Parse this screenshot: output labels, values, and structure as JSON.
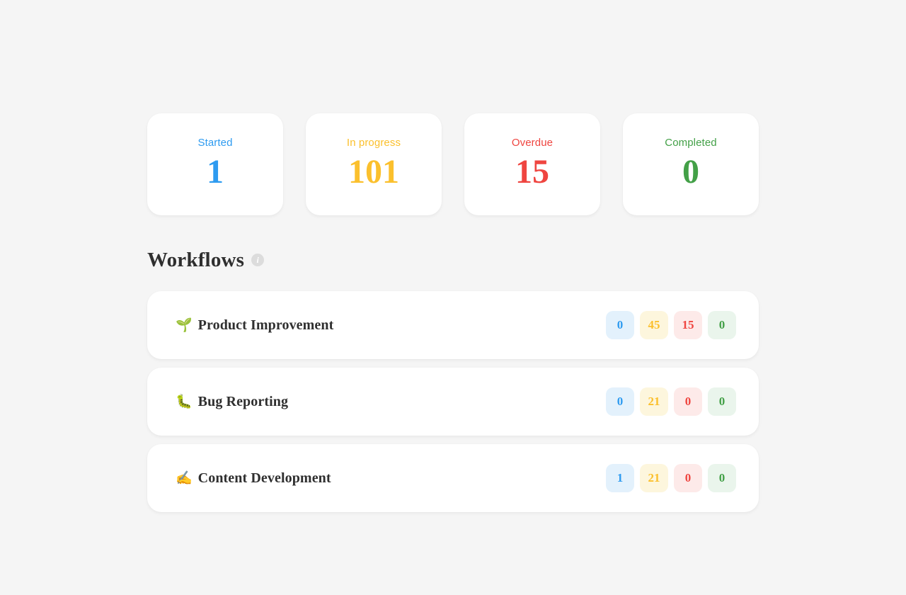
{
  "theme": {
    "background": "#f5f5f5",
    "card_background": "#ffffff",
    "heading_color": "#2f2f2f",
    "started_color": "#2e9bf0",
    "in_progress_color": "#fbc02d",
    "overdue_color": "#ef4540",
    "completed_color": "#43a047",
    "started_badge_bg": "#e3f1fc",
    "in_progress_badge_bg": "#fdf6dd",
    "overdue_badge_bg": "#fdeae9",
    "completed_badge_bg": "#eaf5ec",
    "info_icon_bg": "#dcdcdc"
  },
  "stats": [
    {
      "label": "Started",
      "value": "1",
      "color": "#2e9bf0",
      "name": "started"
    },
    {
      "label": "In progress",
      "value": "101",
      "color": "#fbc02d",
      "name": "in-progress"
    },
    {
      "label": "Overdue",
      "value": "15",
      "color": "#ef4540",
      "name": "overdue"
    },
    {
      "label": "Completed",
      "value": "0",
      "color": "#43a047",
      "name": "completed"
    }
  ],
  "workflows_section": {
    "title": "Workflows",
    "info_icon": "info-icon",
    "info_glyph": "i"
  },
  "workflows": [
    {
      "emoji": "🌱",
      "emoji_name": "seedling-icon",
      "name": "Product Improvement",
      "counts": [
        {
          "value": "0",
          "color": "#2e9bf0",
          "bg": "#e3f1fc",
          "status": "started"
        },
        {
          "value": "45",
          "color": "#fbc02d",
          "bg": "#fdf6dd",
          "status": "in-progress"
        },
        {
          "value": "15",
          "color": "#ef4540",
          "bg": "#fdeae9",
          "status": "overdue"
        },
        {
          "value": "0",
          "color": "#43a047",
          "bg": "#eaf5ec",
          "status": "completed"
        }
      ]
    },
    {
      "emoji": "🐛",
      "emoji_name": "bug-icon",
      "name": "Bug Reporting",
      "counts": [
        {
          "value": "0",
          "color": "#2e9bf0",
          "bg": "#e3f1fc",
          "status": "started"
        },
        {
          "value": "21",
          "color": "#fbc02d",
          "bg": "#fdf6dd",
          "status": "in-progress"
        },
        {
          "value": "0",
          "color": "#ef4540",
          "bg": "#fdeae9",
          "status": "overdue"
        },
        {
          "value": "0",
          "color": "#43a047",
          "bg": "#eaf5ec",
          "status": "completed"
        }
      ]
    },
    {
      "emoji": "✍️",
      "emoji_name": "writing-hand-icon",
      "name": "Content Development",
      "counts": [
        {
          "value": "1",
          "color": "#2e9bf0",
          "bg": "#e3f1fc",
          "status": "started"
        },
        {
          "value": "21",
          "color": "#fbc02d",
          "bg": "#fdf6dd",
          "status": "in-progress"
        },
        {
          "value": "0",
          "color": "#ef4540",
          "bg": "#fdeae9",
          "status": "overdue"
        },
        {
          "value": "0",
          "color": "#43a047",
          "bg": "#eaf5ec",
          "status": "completed"
        }
      ]
    }
  ]
}
